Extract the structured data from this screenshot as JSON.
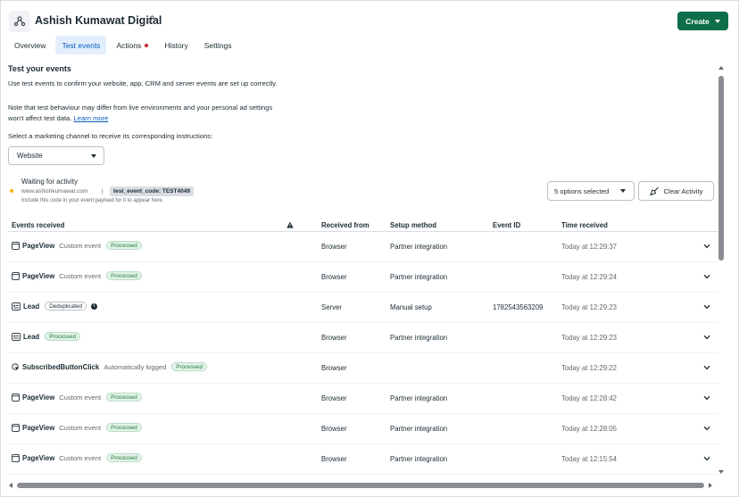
{
  "header": {
    "title": "Ashish Kumawat Digital",
    "create_label": "Create"
  },
  "tabs": [
    {
      "label": "Overview",
      "active": false
    },
    {
      "label": "Test events",
      "active": true
    },
    {
      "label": "Actions",
      "active": false,
      "alert": true
    },
    {
      "label": "History",
      "active": false
    },
    {
      "label": "Settings",
      "active": false
    }
  ],
  "intro": {
    "title": "Test your events",
    "description": "Use test events to confirm your website, app, CRM and server events are set up correctly.",
    "note_line1": "Note that test behaviour may differ from live environments and your personal ad settings",
    "note_line2": "won't affect test data.",
    "learn_more": "Learn more",
    "channel_label": "Select a marketing channel to receive its corresponding instructions:",
    "channel_value": "Website"
  },
  "status": {
    "title": "Waiting for activity",
    "site": "www.ashishkumawat.com",
    "separator": "|",
    "code": "test_event_code: TEST4049",
    "hint": "Include this code in your event payload for it to appear here.",
    "options_label": "5 options selected",
    "clear_label": "Clear Activity"
  },
  "table": {
    "headers": {
      "events": "Events received",
      "from": "Received from",
      "setup": "Setup method",
      "id": "Event ID",
      "time": "Time received"
    },
    "rows": [
      {
        "icon": "page-icon",
        "name": "PageView",
        "type": "Custom event",
        "badge": "Processed",
        "badge_kind": "processed",
        "from": "Browser",
        "setup": "Partner integration",
        "id": "",
        "time": "Today at 12:29:37"
      },
      {
        "icon": "page-icon",
        "name": "PageView",
        "type": "Custom event",
        "badge": "Processed",
        "badge_kind": "processed",
        "from": "Browser",
        "setup": "Partner integration",
        "id": "",
        "time": "Today at 12:29:24"
      },
      {
        "icon": "lead-icon",
        "name": "Lead",
        "type": "",
        "badge": "Deduplicated",
        "badge_kind": "dedup",
        "info": "i",
        "from": "Server",
        "setup": "Manual setup",
        "id": "1782543563209",
        "time": "Today at 12:29:23"
      },
      {
        "icon": "lead-icon",
        "name": "Lead",
        "type": "",
        "badge": "Processed",
        "badge_kind": "processed",
        "from": "Browser",
        "setup": "Partner integration",
        "id": "",
        "time": "Today at 12:29:23"
      },
      {
        "icon": "button-click-icon",
        "name": "SubscribedButtonClick",
        "type": "Automatically logged",
        "badge": "Processed",
        "badge_kind": "processed",
        "from": "Browser",
        "setup": "",
        "id": "",
        "time": "Today at 12:29:22"
      },
      {
        "icon": "page-icon",
        "name": "PageView",
        "type": "Custom event",
        "badge": "Processed",
        "badge_kind": "processed",
        "from": "Browser",
        "setup": "Partner integration",
        "id": "",
        "time": "Today at 12:28:42"
      },
      {
        "icon": "page-icon",
        "name": "PageView",
        "type": "Custom event",
        "badge": "Processed",
        "badge_kind": "processed",
        "from": "Browser",
        "setup": "Partner integration",
        "id": "",
        "time": "Today at 12:28:05"
      },
      {
        "icon": "page-icon",
        "name": "PageView",
        "type": "Custom event",
        "badge": "Processed",
        "badge_kind": "processed",
        "from": "Browser",
        "setup": "Partner integration",
        "id": "",
        "time": "Today at 12:15:54"
      }
    ]
  }
}
